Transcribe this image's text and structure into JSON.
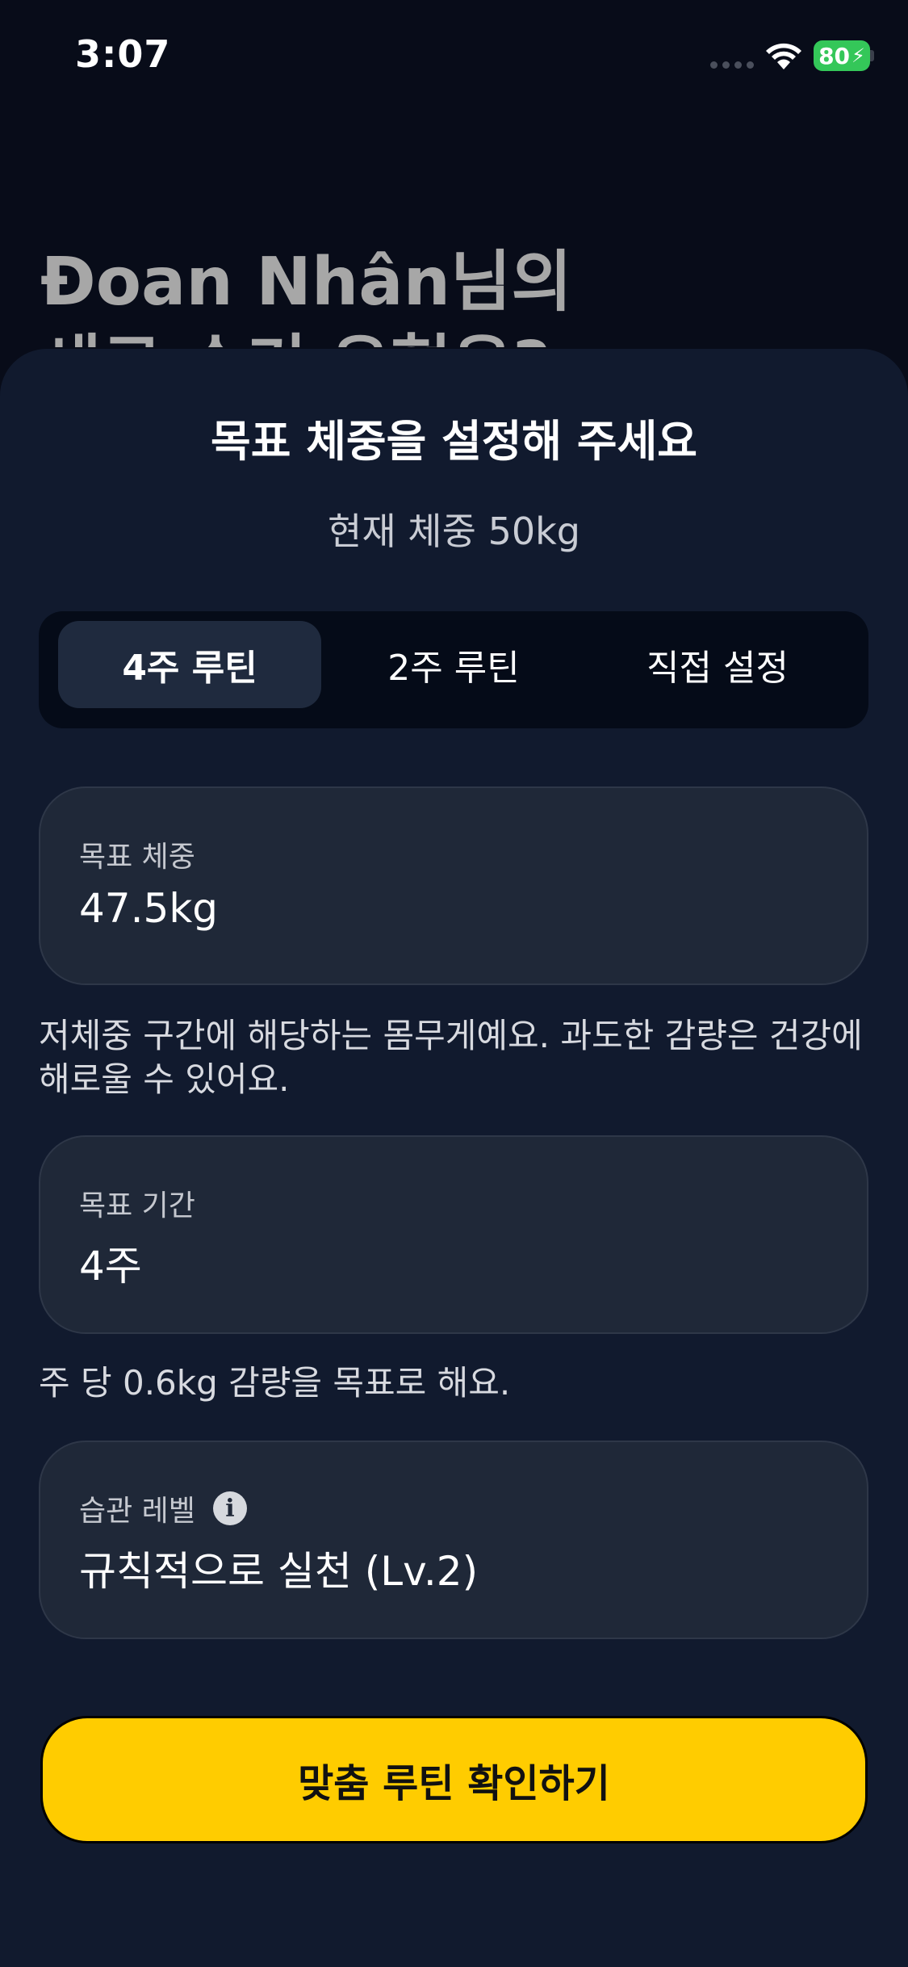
{
  "status_bar": {
    "time": "3:07",
    "battery_level": "80",
    "battery_color": "#34c759"
  },
  "background": {
    "heading_line1": "Đoan Nhân님의",
    "heading_line2": "새로 수기 유형은?"
  },
  "sheet": {
    "title": "목표 체중을 설정해 주세요",
    "current_weight": "현재 체중 50kg",
    "tabs": [
      {
        "label": "4주 루틴",
        "selected": true
      },
      {
        "label": "2주 루틴",
        "selected": false
      },
      {
        "label": "직접 설정",
        "selected": false
      }
    ],
    "target_weight": {
      "label": "목표 체중",
      "value": "47.5kg",
      "helper": "저체중 구간에 해당하는 몸무게예요. 과도한 감량은 건강에 해로울 수 있어요."
    },
    "target_period": {
      "label": "목표 기간",
      "value": "4주",
      "helper": "주 당 0.6kg 감량을 목표로 해요."
    },
    "habit_level": {
      "label": "습관 레벨",
      "info_icon": "i",
      "value": "규칙적으로 실천 (Lv.2)"
    },
    "cta_label": "맞춤 루틴 확인하기",
    "accent_color": "#ffcc00"
  }
}
